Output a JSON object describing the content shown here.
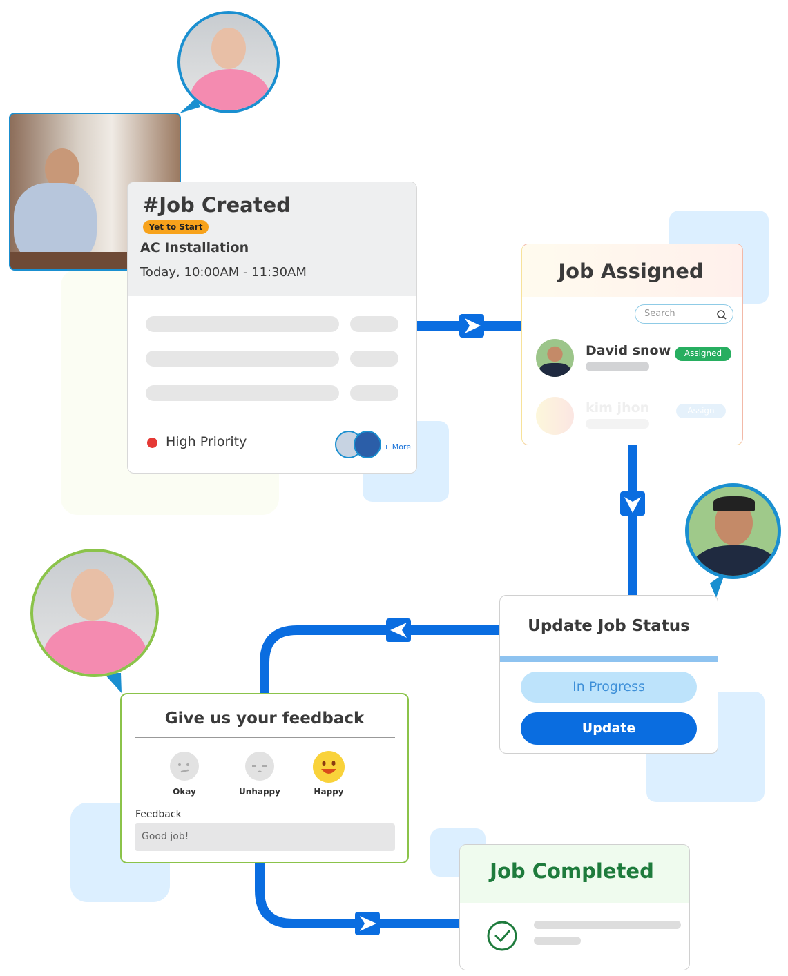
{
  "job_created": {
    "title": "#Job Created",
    "status_badge": "Yet to Start",
    "job_name": "AC Installation",
    "time": "Today, 10:00AM - 11:30AM",
    "priority": "High Priority",
    "more_label": "+ More"
  },
  "job_assigned": {
    "title": "Job Assigned",
    "search_placeholder": "Search",
    "technicians": [
      {
        "name": "David snow",
        "badge": "Assigned"
      },
      {
        "name": "kim jhon",
        "badge": "Assign"
      }
    ]
  },
  "update_status": {
    "title": "Update Job Status",
    "in_progress_label": "In Progress",
    "update_label": "Update"
  },
  "feedback": {
    "title": "Give us your feedback",
    "ratings": [
      {
        "label": "Okay",
        "icon": "neutral-face-icon"
      },
      {
        "label": "Unhappy",
        "icon": "sad-face-icon"
      },
      {
        "label": "Happy",
        "icon": "happy-face-icon",
        "selected": true
      }
    ],
    "field_label": "Feedback",
    "field_value": "Good job!"
  },
  "job_completed": {
    "title": "Job Completed"
  },
  "colors": {
    "connector": "#0a6de0",
    "badge_orange": "#f7a21b",
    "badge_green": "#27ae60",
    "completed_green": "#1e7b3c",
    "priority_red": "#e53935"
  }
}
